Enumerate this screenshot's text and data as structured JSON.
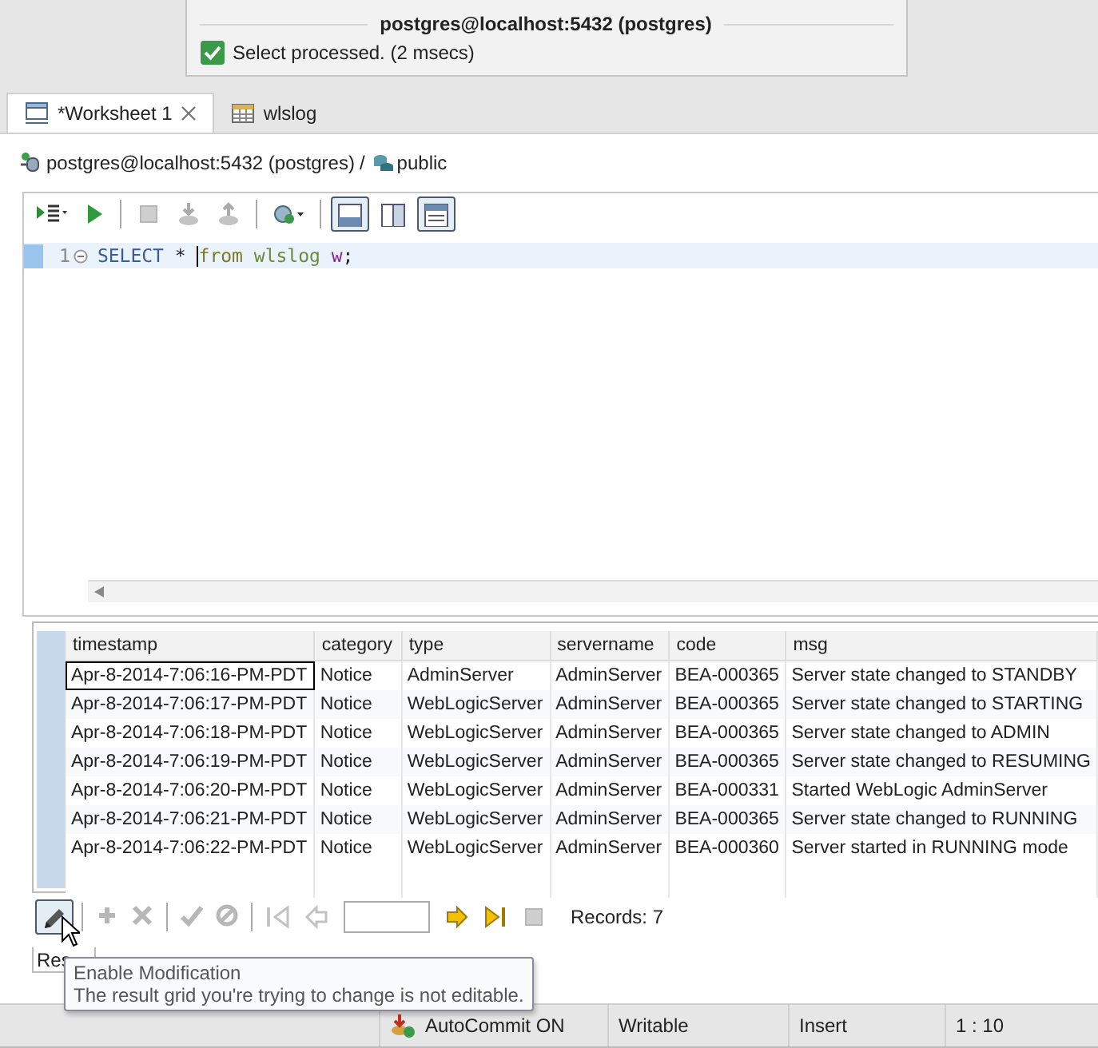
{
  "notification": {
    "title": "postgres@localhost:5432 (postgres)",
    "message": "Select processed. (2 msecs)"
  },
  "tabs": [
    {
      "label": "*Worksheet 1",
      "kind": "sql",
      "selected": true,
      "closable": true
    },
    {
      "label": "wlslog",
      "kind": "table",
      "selected": false,
      "closable": false
    }
  ],
  "breadcrumb": {
    "connection": "postgres@localhost:5432 (postgres)",
    "separator": "/",
    "schema": "public"
  },
  "editor_toolbar": [
    {
      "kind": "execute",
      "disabled": false,
      "pressed": false
    },
    {
      "kind": "run",
      "disabled": false,
      "pressed": false
    },
    {
      "kind": "sep"
    },
    {
      "kind": "stop",
      "disabled": true,
      "pressed": false
    },
    {
      "kind": "export",
      "disabled": true,
      "pressed": false
    },
    {
      "kind": "import",
      "disabled": true,
      "pressed": false
    },
    {
      "kind": "sep"
    },
    {
      "kind": "connect",
      "disabled": false,
      "pressed": false
    },
    {
      "kind": "sep"
    },
    {
      "kind": "layout-below",
      "disabled": false,
      "pressed": true
    },
    {
      "kind": "layout-side",
      "disabled": false,
      "pressed": false
    },
    {
      "kind": "layout-max",
      "disabled": false,
      "pressed": true
    }
  ],
  "editor": {
    "lines": [
      {
        "number": "1",
        "tokens": [
          {
            "kind": "keyword",
            "text": "SELECT"
          },
          {
            "kind": "plain",
            "text": " * "
          },
          {
            "kind": "keyword2",
            "text": "from",
            "caret_before": true
          },
          {
            "kind": "table",
            "text": " wlslog"
          },
          {
            "kind": "alias",
            "text": " w"
          },
          {
            "kind": "plain",
            "text": ";"
          }
        ],
        "current": true
      }
    ]
  },
  "results": {
    "columns": [
      "timestamp",
      "category",
      "type",
      "servername",
      "code",
      "msg"
    ],
    "rows": [
      {
        "focused": true,
        "cells": [
          "Apr-8-2014-7:06:16-PM-PDT",
          "Notice",
          "AdminServer",
          "AdminServer",
          "BEA-000365",
          "Server state changed to STANDBY"
        ]
      },
      {
        "focused": false,
        "cells": [
          "Apr-8-2014-7:06:17-PM-PDT",
          "Notice",
          "WebLogicServer",
          "AdminServer",
          "BEA-000365",
          "Server state changed to STARTING"
        ]
      },
      {
        "focused": false,
        "cells": [
          "Apr-8-2014-7:06:18-PM-PDT",
          "Notice",
          "WebLogicServer",
          "AdminServer",
          "BEA-000365",
          "Server state changed to ADMIN"
        ]
      },
      {
        "focused": false,
        "cells": [
          "Apr-8-2014-7:06:19-PM-PDT",
          "Notice",
          "WebLogicServer",
          "AdminServer",
          "BEA-000365",
          "Server state changed to RESUMING"
        ]
      },
      {
        "focused": false,
        "cells": [
          "Apr-8-2014-7:06:20-PM-PDT",
          "Notice",
          "WebLogicServer",
          "AdminServer",
          "BEA-000331",
          "Started WebLogic AdminServer"
        ]
      },
      {
        "focused": false,
        "cells": [
          "Apr-8-2014-7:06:21-PM-PDT",
          "Notice",
          "WebLogicServer",
          "AdminServer",
          "BEA-000365",
          "Server state changed to RUNNING"
        ]
      },
      {
        "focused": false,
        "cells": [
          "Apr-8-2014-7:06:22-PM-PDT",
          "Notice",
          "WebLogicServer",
          "AdminServer",
          "BEA-000360",
          "Server started in RUNNING mode"
        ]
      }
    ]
  },
  "results_toolbar": [
    {
      "kind": "edit",
      "disabled": false,
      "pressed": true
    },
    {
      "kind": "sep"
    },
    {
      "kind": "add",
      "disabled": true
    },
    {
      "kind": "delete",
      "disabled": true
    },
    {
      "kind": "sep"
    },
    {
      "kind": "save",
      "disabled": true
    },
    {
      "kind": "cancel",
      "disabled": true
    },
    {
      "kind": "sep"
    },
    {
      "kind": "first",
      "disabled": true
    },
    {
      "kind": "prev",
      "disabled": true
    },
    {
      "kind": "field"
    },
    {
      "kind": "next",
      "disabled": false
    },
    {
      "kind": "last",
      "disabled": false
    },
    {
      "kind": "stop",
      "disabled": true
    }
  ],
  "records": "Records: 7",
  "result_tab": "Res",
  "tooltip": {
    "title": "Enable Modification",
    "text": "The result grid you're trying to change is not editable."
  },
  "status_bar": [
    {
      "kind": "autocommit",
      "text": "AutoCommit ON"
    },
    {
      "kind": "plain",
      "text": "Writable"
    },
    {
      "kind": "plain",
      "text": "Insert"
    },
    {
      "kind": "plain",
      "text": "1 : 10"
    }
  ]
}
